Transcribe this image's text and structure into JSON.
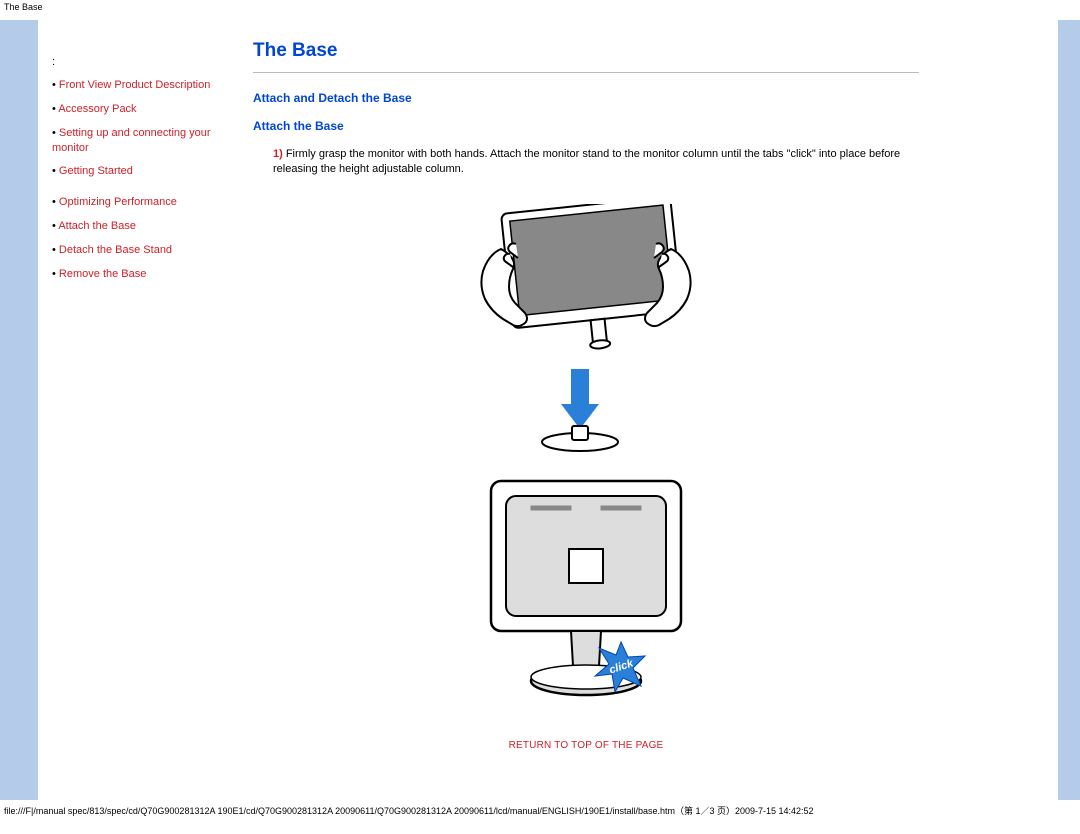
{
  "header": {
    "top_title": "The Base"
  },
  "sidebar": {
    "colon": ":",
    "items": [
      {
        "label": "Front View Product Description"
      },
      {
        "label": "Accessory Pack"
      },
      {
        "label": "Setting up and connecting your monitor"
      },
      {
        "label": "Getting Started"
      },
      {
        "label": "Optimizing Performance"
      },
      {
        "label": "Attach the Base"
      },
      {
        "label": "Detach the Base Stand"
      },
      {
        "label": "Remove the Base"
      }
    ]
  },
  "main": {
    "h1": "The Base",
    "h2": "Attach and Detach the Base",
    "h3": "Attach the Base",
    "step_num": "1)",
    "step_text": " Firmly grasp the monitor with both hands. Attach the monitor stand to the monitor column until the tabs \"click\" into place before releasing the height adjustable column.",
    "return_link": "RETURN TO TOP OF THE PAGE",
    "click_label": "click"
  },
  "footer": {
    "path": "file:///F|/manual spec/813/spec/cd/Q70G900281312A 190E1/cd/Q70G900281312A 20090611/Q70G900281312A 20090611/lcd/manual/ENGLISH/190E1/install/base.htm（第 1／3 页）2009-7-15 14:42:52"
  }
}
